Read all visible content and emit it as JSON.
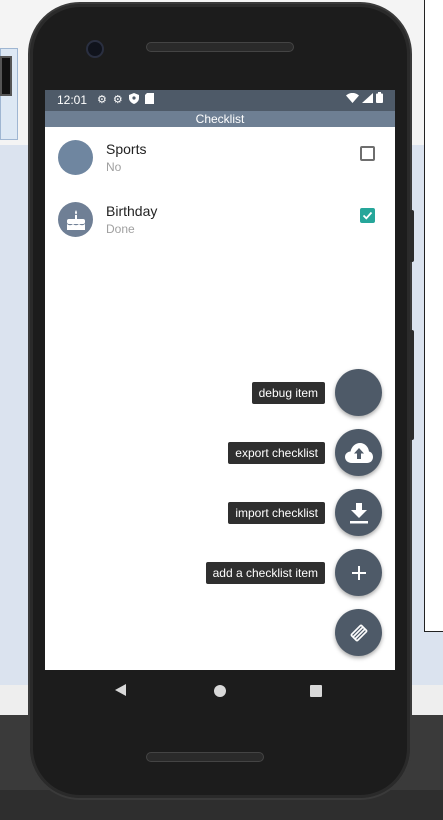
{
  "status_bar": {
    "time": "12:01",
    "left_icons": [
      "gear-icon",
      "gear-icon",
      "shield-icon",
      "sd-card-icon"
    ],
    "right_icons": [
      "wifi-icon",
      "signal-icon",
      "battery-icon"
    ]
  },
  "app_bar": {
    "title": "Checklist"
  },
  "checklist": {
    "items": [
      {
        "title": "Sports",
        "status": "No",
        "checked": false,
        "avatar_icon": "blank-avatar"
      },
      {
        "title": "Birthday",
        "status": "Done",
        "checked": true,
        "avatar_icon": "cake-icon"
      }
    ]
  },
  "fab_menu": {
    "actions": [
      {
        "label": "debug item",
        "icon": "blank-icon"
      },
      {
        "label": "export checklist",
        "icon": "cloud-upload-icon"
      },
      {
        "label": "import checklist",
        "icon": "download-icon"
      },
      {
        "label": "add a checklist item",
        "icon": "plus-icon"
      }
    ],
    "main_icon": "pencil-icon"
  },
  "nav_bar": {
    "buttons": [
      "back-icon",
      "home-icon",
      "recents-icon"
    ]
  },
  "colors": {
    "status_bar": "#4e5a68",
    "app_bar": "#6e7f93",
    "fab": "#4e5a68",
    "check_accent": "#26a69a"
  }
}
